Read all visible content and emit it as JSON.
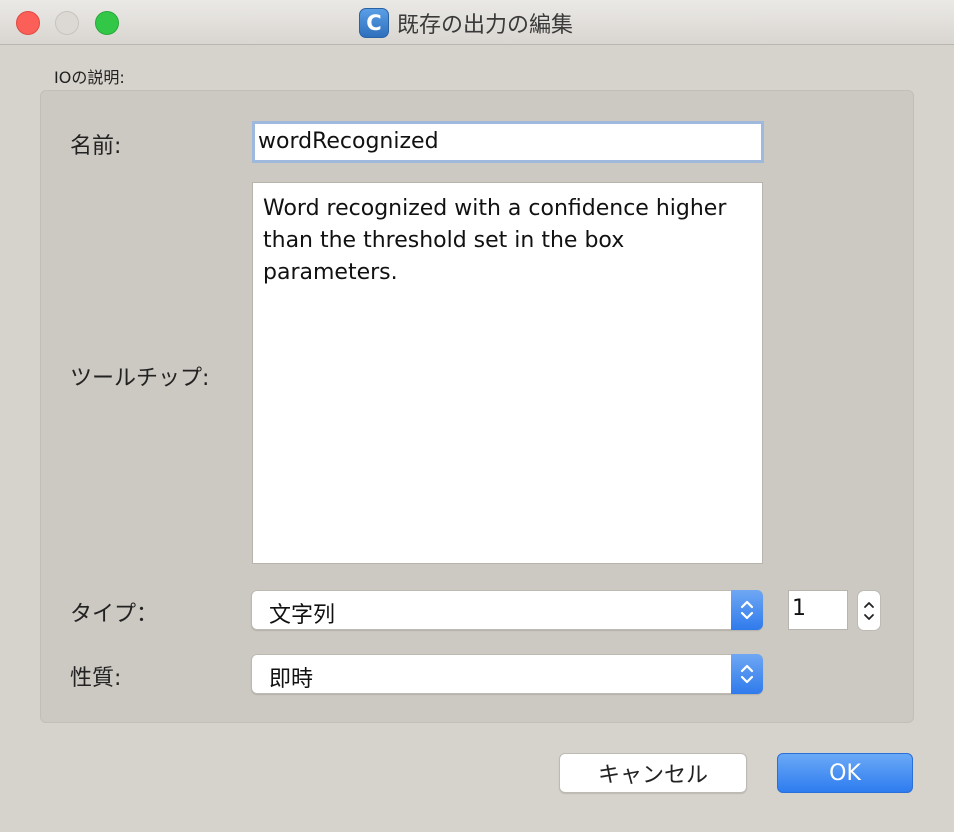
{
  "window": {
    "title": "既存の出力の編集",
    "app_icon_letter": "C"
  },
  "group": {
    "label": "IOの説明:"
  },
  "form": {
    "name_label": "名前:",
    "name_value": "wordRecognized",
    "tooltip_label": "ツールチップ:",
    "tooltip_value": "Word recognized with a confidence higher than the threshold set in the box parameters.",
    "type_label": "タイプ：",
    "type_value": "文字列",
    "count_value": "1",
    "nature_label": "性質:",
    "nature_value": "即時"
  },
  "buttons": {
    "cancel": "キャンセル",
    "ok": "OK"
  },
  "colors": {
    "accent": "#2f7bec",
    "close": "#fc5f57",
    "maximize": "#33c748"
  }
}
